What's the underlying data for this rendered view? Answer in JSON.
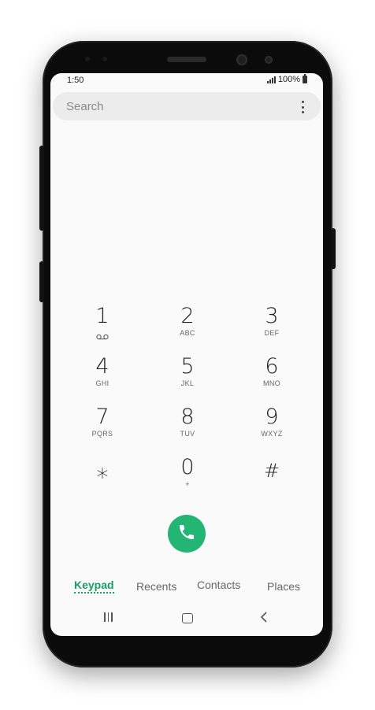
{
  "status_bar": {
    "time": "1:50",
    "battery": "100%"
  },
  "search": {
    "placeholder": "Search",
    "more_icon": "more-vert-icon"
  },
  "keypad": {
    "keys": [
      {
        "digit": "1",
        "letters": "",
        "icon": "voicemail-icon"
      },
      {
        "digit": "2",
        "letters": "ABC"
      },
      {
        "digit": "3",
        "letters": "DEF"
      },
      {
        "digit": "4",
        "letters": "GHI"
      },
      {
        "digit": "5",
        "letters": "JKL"
      },
      {
        "digit": "6",
        "letters": "MNO"
      },
      {
        "digit": "7",
        "letters": "PQRS"
      },
      {
        "digit": "8",
        "letters": "TUV"
      },
      {
        "digit": "9",
        "letters": "WXYZ"
      },
      {
        "digit": "⁎",
        "letters": ""
      },
      {
        "digit": "0",
        "letters": "+"
      },
      {
        "digit": "#",
        "letters": ""
      }
    ]
  },
  "call": {
    "icon": "phone-icon",
    "color": "#22b573"
  },
  "tabs": [
    {
      "label": "Keypad",
      "active": true
    },
    {
      "label": "Recents",
      "active": false
    },
    {
      "label": "Contacts",
      "active": false
    },
    {
      "label": "Places",
      "active": false
    }
  ],
  "colors": {
    "accent": "#1a9e63",
    "screen_bg": "#fafafa"
  },
  "nav": {
    "recent_icon": "recent-apps-icon",
    "home_icon": "home-icon",
    "back_icon": "back-icon"
  }
}
